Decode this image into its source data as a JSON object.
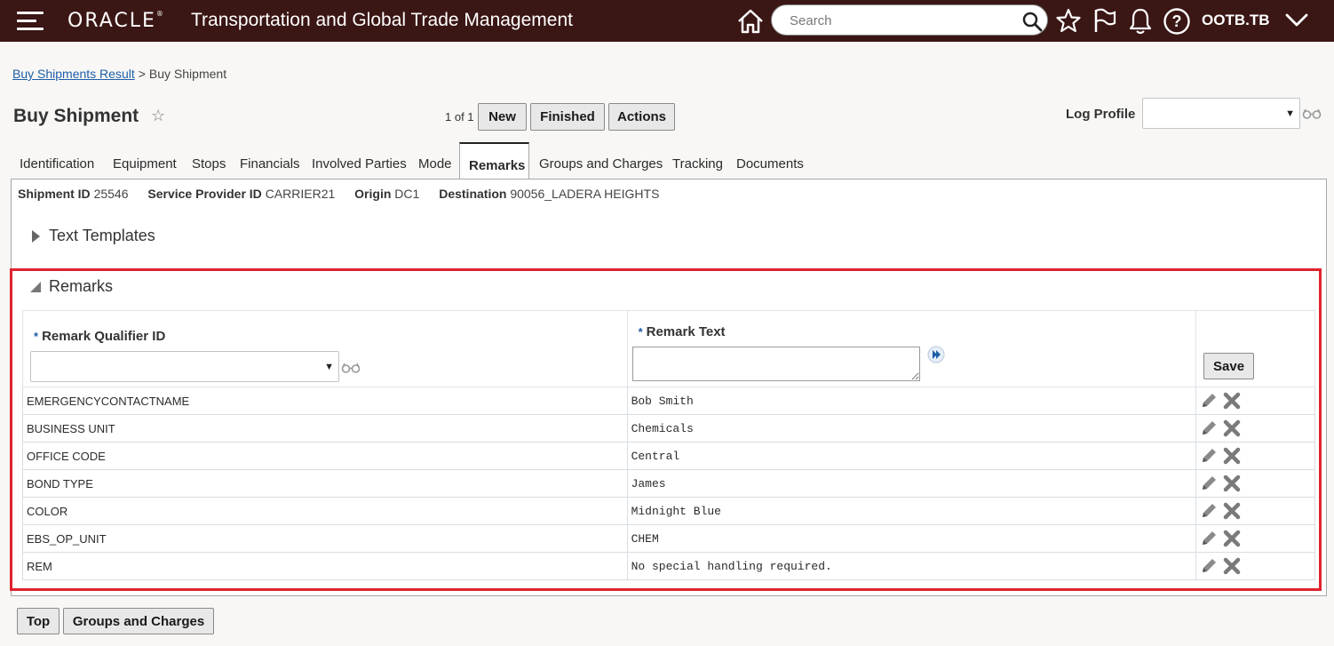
{
  "topbar": {
    "brand": "ORACLE",
    "title": "Transportation and Global Trade Management",
    "search_placeholder": "Search",
    "user": "OOTB.TB"
  },
  "breadcrumb": {
    "link": "Buy Shipments Result",
    "separator": ">",
    "current": "Buy Shipment"
  },
  "page": {
    "title": "Buy Shipment",
    "pager": "1 of 1",
    "buttons": {
      "new": "New",
      "finished": "Finished",
      "actions": "Actions"
    },
    "log_profile_label": "Log Profile",
    "log_profile_value": ""
  },
  "tabs": [
    "Identification",
    "Equipment",
    "Stops",
    "Financials",
    "Involved Parties",
    "Mode",
    "Remarks",
    "Groups and Charges",
    "Tracking",
    "Documents"
  ],
  "active_tab": "Remarks",
  "summary": {
    "shipment_id_label": "Shipment ID",
    "shipment_id": "25546",
    "service_provider_label": "Service Provider ID",
    "service_provider": "CARRIER21",
    "origin_label": "Origin",
    "origin": "DC1",
    "destination_label": "Destination",
    "destination": "90056_LADERA HEIGHTS"
  },
  "sections": {
    "text_templates": "Text Templates",
    "remarks": "Remarks"
  },
  "remarks_table": {
    "required_marker": "*",
    "col_qualifier": "Remark Qualifier ID",
    "col_text": "Remark Text",
    "save_label": "Save",
    "rows": [
      {
        "qualifier": "EMERGENCYCONTACTNAME",
        "text": "Bob Smith"
      },
      {
        "qualifier": "BUSINESS UNIT",
        "text": "Chemicals"
      },
      {
        "qualifier": "OFFICE CODE",
        "text": "Central"
      },
      {
        "qualifier": "BOND TYPE",
        "text": "James"
      },
      {
        "qualifier": "COLOR",
        "text": "Midnight Blue"
      },
      {
        "qualifier": "EBS_OP_UNIT",
        "text": "CHEM"
      },
      {
        "qualifier": "REM",
        "text": "No special handling required."
      }
    ]
  },
  "bottom_buttons": {
    "top": "Top",
    "groups_and_charges": "Groups and Charges"
  },
  "colors": {
    "topbar": "#3a1614",
    "highlight": "#e0232e",
    "link": "#1e5ea8"
  }
}
